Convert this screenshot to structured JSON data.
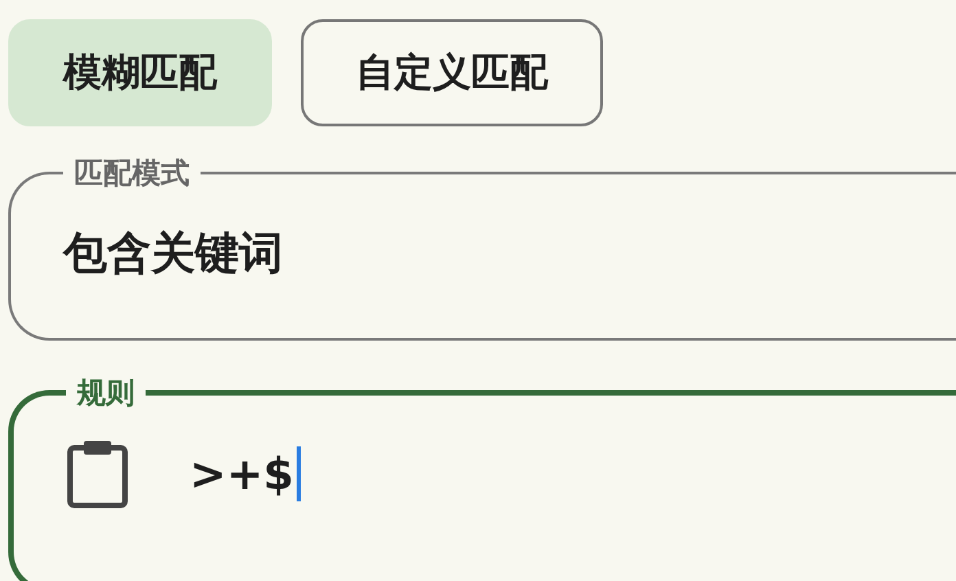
{
  "chips": [
    {
      "label": "模糊匹配",
      "selected": true
    },
    {
      "label": "自定义匹配",
      "selected": false
    }
  ],
  "fields": [
    {
      "label": "匹配模式",
      "value": "包含关键词",
      "focused": false,
      "kind": "select"
    },
    {
      "label": "规则",
      "value": ">+$",
      "focused": true,
      "kind": "text"
    }
  ]
}
